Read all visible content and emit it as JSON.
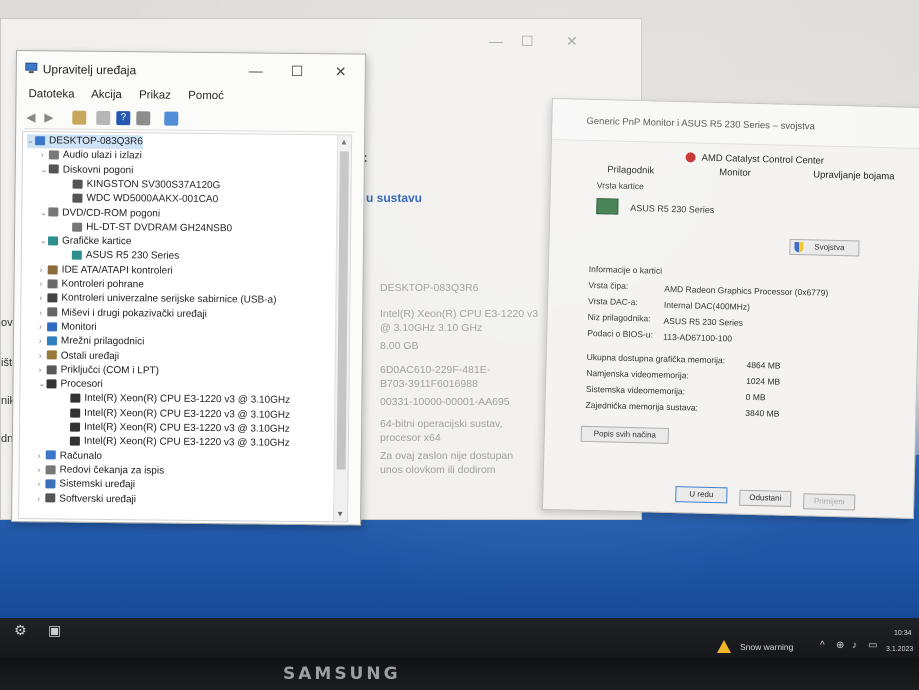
{
  "device_manager": {
    "title": "Upravitelj uređaja",
    "menu": [
      "Datoteka",
      "Akcija",
      "Prikaz",
      "Pomoć"
    ],
    "tree": [
      {
        "label": "DESKTOP-083Q3R6",
        "level": 0,
        "expanded": true,
        "selected": true,
        "icon": "computer-icon"
      },
      {
        "label": "Audio ulazi i izlazi",
        "level": 1,
        "expanded": false,
        "icon": "audio-icon"
      },
      {
        "label": "Diskovni pogoni",
        "level": 1,
        "expanded": true,
        "icon": "disk-icon"
      },
      {
        "label": "KINGSTON SV300S37A120G",
        "level": 2,
        "icon": "disk-icon"
      },
      {
        "label": "WDC WD5000AAKX-001CA0",
        "level": 2,
        "icon": "disk-icon"
      },
      {
        "label": "DVD/CD-ROM pogoni",
        "level": 1,
        "expanded": true,
        "icon": "dvd-icon"
      },
      {
        "label": "HL-DT-ST DVDRAM GH24NSB0",
        "level": 2,
        "icon": "dvd-icon"
      },
      {
        "label": "Grafičke kartice",
        "level": 1,
        "expanded": true,
        "icon": "display-adapter-icon"
      },
      {
        "label": "ASUS R5 230 Series",
        "level": 2,
        "icon": "display-adapter-icon"
      },
      {
        "label": "IDE ATA/ATAPI kontroleri",
        "level": 1,
        "expanded": false,
        "icon": "ide-icon"
      },
      {
        "label": "Kontroleri pohrane",
        "level": 1,
        "expanded": false,
        "icon": "storage-controller-icon"
      },
      {
        "label": "Kontroleri univerzalne serijske sabirnice (USB-a)",
        "level": 1,
        "expanded": false,
        "icon": "usb-icon"
      },
      {
        "label": "Miševi i drugi pokazivački uređaji",
        "level": 1,
        "expanded": false,
        "icon": "mouse-icon"
      },
      {
        "label": "Monitori",
        "level": 1,
        "expanded": false,
        "icon": "monitor-icon"
      },
      {
        "label": "Mrežni prilagodnici",
        "level": 1,
        "expanded": false,
        "icon": "network-icon"
      },
      {
        "label": "Ostali uređaji",
        "level": 1,
        "expanded": false,
        "icon": "other-devices-icon"
      },
      {
        "label": "Priključci (COM i LPT)",
        "level": 1,
        "expanded": false,
        "icon": "ports-icon"
      },
      {
        "label": "Procesori",
        "level": 1,
        "expanded": true,
        "icon": "processor-icon"
      },
      {
        "label": "Intel(R) Xeon(R) CPU E3-1220 v3 @ 3.10GHz",
        "level": 2,
        "icon": "processor-icon"
      },
      {
        "label": "Intel(R) Xeon(R) CPU E3-1220 v3 @ 3.10GHz",
        "level": 2,
        "icon": "processor-icon"
      },
      {
        "label": "Intel(R) Xeon(R) CPU E3-1220 v3 @ 3.10GHz",
        "level": 2,
        "icon": "processor-icon"
      },
      {
        "label": "Intel(R) Xeon(R) CPU E3-1220 v3 @ 3.10GHz",
        "level": 2,
        "icon": "processor-icon"
      },
      {
        "label": "Računalo",
        "level": 1,
        "expanded": false,
        "icon": "computer-icon"
      },
      {
        "label": "Redovi čekanja za ispis",
        "level": 1,
        "expanded": false,
        "icon": "print-queue-icon"
      },
      {
        "label": "Sistemski uređaji",
        "level": 1,
        "expanded": false,
        "icon": "system-devices-icon"
      },
      {
        "label": "Softverski uređaji",
        "level": 1,
        "expanded": false,
        "icon": "software-devices-icon"
      }
    ]
  },
  "system_window": {
    "section_link": "u sustavu",
    "left_labels": [
      "ovaj PC",
      "ištena suč",
      "nik",
      "dna površina"
    ],
    "info_lines": [
      "DESKTOP-083Q3R6",
      "Intel(R) Xeon(R) CPU E3-1220 v3",
      "@ 3.10GHz   3.10 GHz",
      "8.00 GB",
      "6D0AC610-229F-481E-",
      "B703-3911F6016988",
      "00331-10000-00001-AA695",
      "64-bitni operacijski sustav,",
      "procesor x64",
      "Za ovaj zaslon nije dostupan",
      "unos olovkom ili dodirom"
    ]
  },
  "monitor_properties": {
    "title": "Generic PnP Monitor i ASUS R5 230 Series – svojstva",
    "tabs": {
      "amd_tab": "AMD Catalyst Control Center",
      "adapter": "Prilagodnik",
      "monitor": "Monitor",
      "color": "Upravljanje bojama"
    },
    "card_type_label": "Vrsta kartice",
    "card_name": "ASUS R5 230 Series",
    "properties_button": "Svojstva",
    "adapter_info_label": "Informacije o kartici",
    "info_rows": [
      {
        "label": "Vrsta čipa:",
        "value": "AMD Radeon Graphics Processor (0x6779)"
      },
      {
        "label": "Vrsta DAC-a:",
        "value": "Internal DAC(400MHz)"
      },
      {
        "label": "Niz prilagodnika:",
        "value": "ASUS R5 230 Series"
      },
      {
        "label": "Podaci o BIOS-u:",
        "value": "113-AD67100-100"
      }
    ],
    "memory_rows": [
      {
        "label": "Ukupna dostupna grafička memorija:",
        "value": "4864 MB"
      },
      {
        "label": "Namjenska videomemorija:",
        "value": "1024 MB"
      },
      {
        "label": "Sistemska videomemorija:",
        "value": "0 MB"
      },
      {
        "label": "Zajednička memorija sustava:",
        "value": "3840 MB"
      }
    ],
    "list_modes_button": "Popis svih načina",
    "ok_button": "U redu",
    "cancel_button": "Odustani",
    "apply_button": "Primijeni"
  },
  "taskbar": {
    "weather_text": "Snow warning",
    "time": "10:34",
    "date": "3.1.2023"
  },
  "bezel": {
    "brand": "SAMSUNG"
  }
}
